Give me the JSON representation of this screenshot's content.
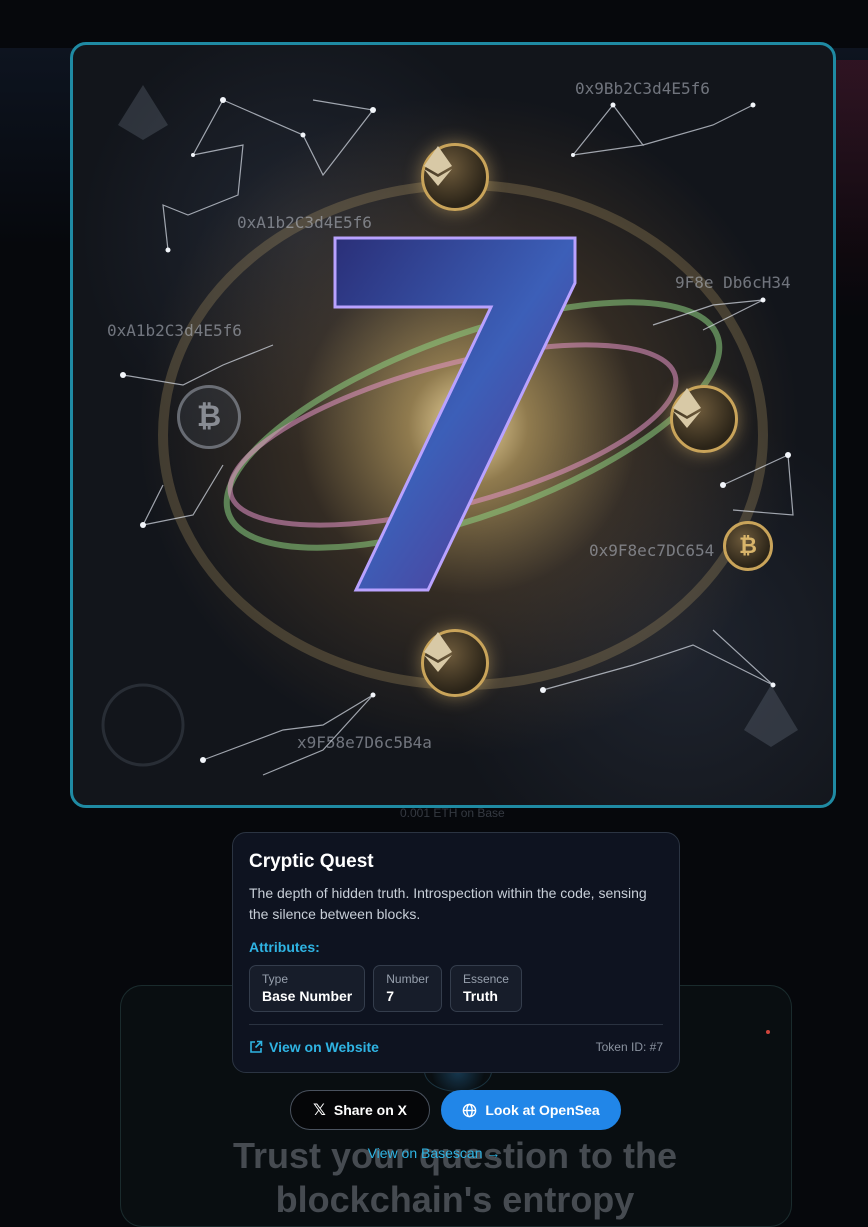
{
  "artwork": {
    "number_glyph": "7",
    "hex_labels": [
      "0x9Bb2C3d4E5f6",
      "0xA1b2C3d4E5f6",
      "0xA1b2C3d4E5f6",
      "9F8e Db6cH34",
      "0x9F8ec7DC654",
      "x9F58e7D6c5B4a"
    ],
    "faint_caption": "0.001 ETH on Base"
  },
  "info": {
    "title": "Cryptic Quest",
    "description": "The depth of hidden truth. Introspection within the code, sensing the silence between blocks.",
    "attributes_label": "Attributes:",
    "attributes": [
      {
        "type": "Type",
        "value": "Base Number"
      },
      {
        "type": "Number",
        "value": "7"
      },
      {
        "type": "Essence",
        "value": "Truth"
      }
    ],
    "website_link": "View on Website",
    "token_id": "Token ID: #7"
  },
  "actions": {
    "share_x": "Share on X",
    "opensea": "Look at OpenSea",
    "basescan": "View on Basescan →"
  },
  "background": {
    "headline": "Trust your question to the blockchain's entropy"
  },
  "colors": {
    "accent": "#2fb4e3",
    "frame_border": "#1f8aa3",
    "opensea_button": "#2186e8"
  }
}
